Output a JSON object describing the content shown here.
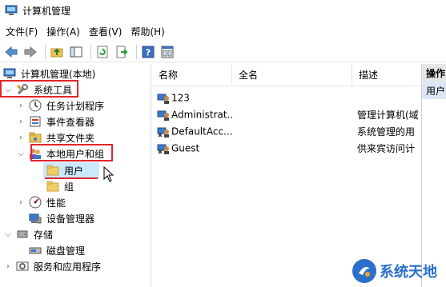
{
  "window": {
    "title": "计算机管理"
  },
  "menu": [
    "文件(F)",
    "操作(A)",
    "查看(V)",
    "帮助(H)"
  ],
  "toolbar": [
    "back-icon",
    "forward-icon",
    "up-folder-icon",
    "show-hide-tree-icon",
    "refresh-icon",
    "export-list-icon",
    "help-icon",
    "properties-icon"
  ],
  "tree": {
    "root": "计算机管理(本地)",
    "system_tools": "系统工具",
    "task_scheduler": "任务计划程序",
    "event_viewer": "事件查看器",
    "shared_folders": "共享文件夹",
    "local_users_groups": "本地用户和组",
    "users": "用户",
    "groups": "组",
    "performance": "性能",
    "device_manager": "设备管理器",
    "storage": "存储",
    "disk_management": "磁盘管理",
    "services_apps": "服务和应用程序"
  },
  "list": {
    "columns": [
      "名称",
      "全名",
      "描述"
    ],
    "rows": [
      {
        "name": "123",
        "full_name": "",
        "description": ""
      },
      {
        "name": "Administrat...",
        "full_name": "",
        "description": "管理计算机(域"
      },
      {
        "name": "DefaultAcc...",
        "full_name": "",
        "description": "系统管理的用"
      },
      {
        "name": "Guest",
        "full_name": "",
        "description": "供来宾访问计"
      }
    ]
  },
  "actions": {
    "header": "操作",
    "item": "用户"
  },
  "watermark": {
    "text": "系统天地"
  },
  "colors": {
    "highlight_red": "#e0262c",
    "selected_bg": "#cce8ff",
    "watermark_blue": "#2a6fc9"
  }
}
